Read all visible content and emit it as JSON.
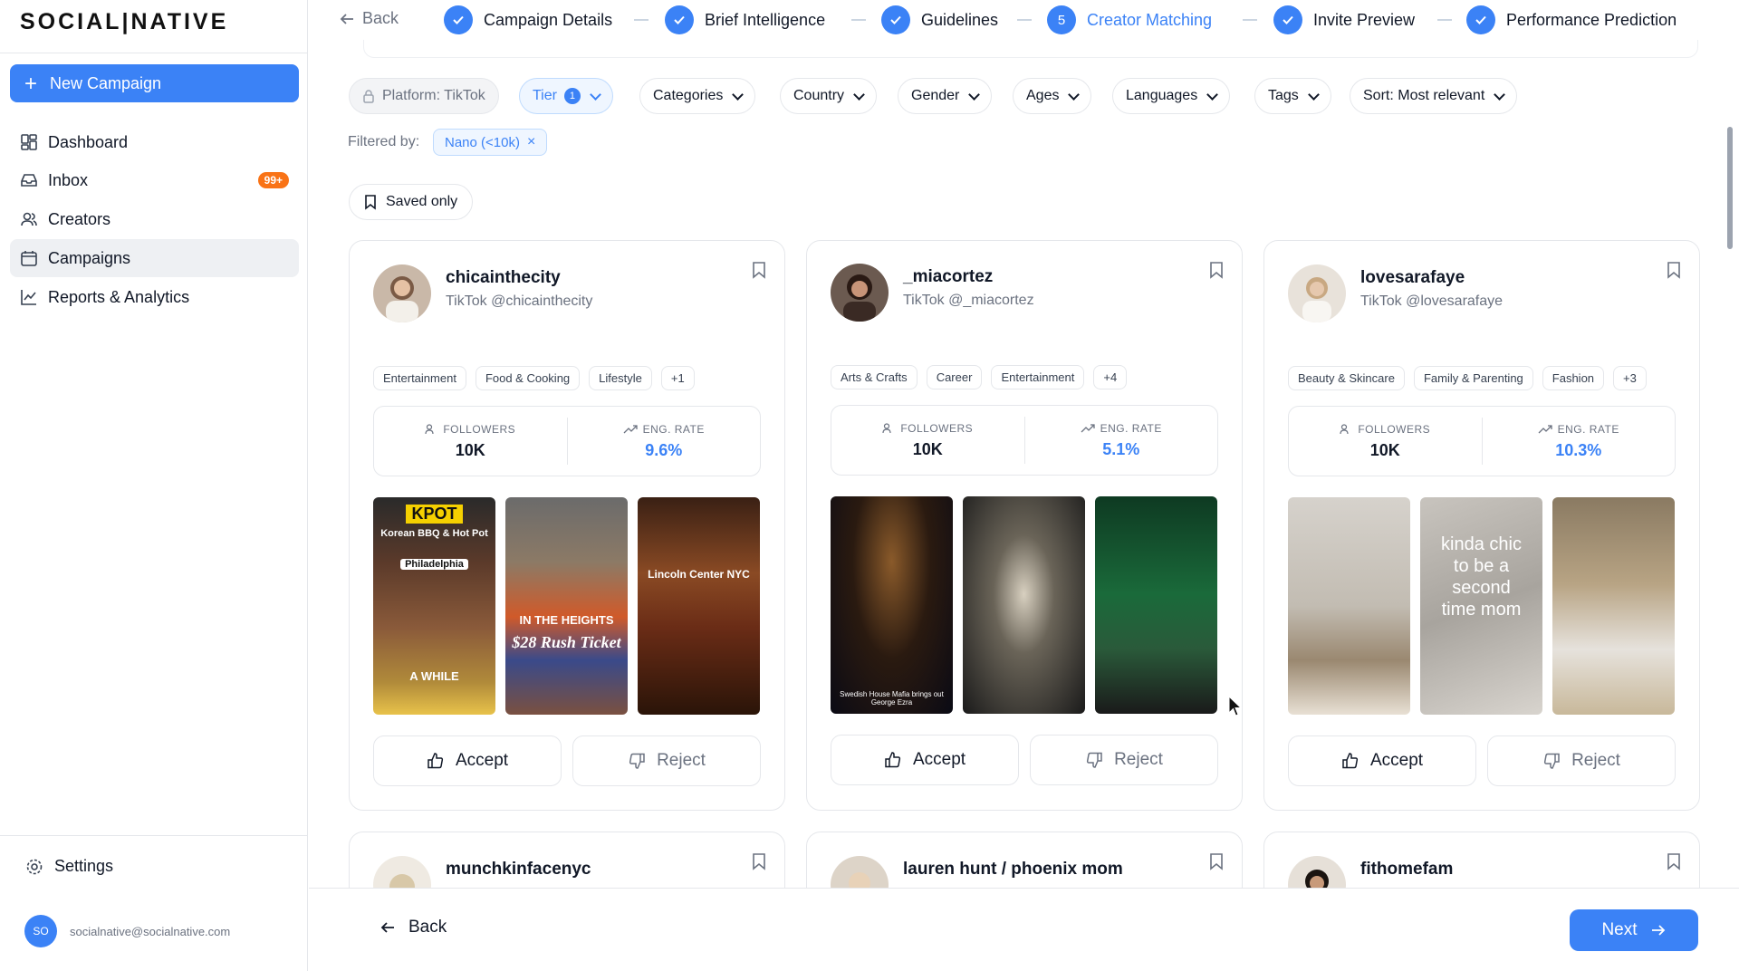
{
  "sidebar": {
    "logo": "SOCIAL|NATIVE",
    "new_campaign": "New Campaign",
    "items": [
      {
        "label": "Dashboard",
        "icon": "dashboard-icon"
      },
      {
        "label": "Inbox",
        "icon": "inbox-icon",
        "badge": "99+"
      },
      {
        "label": "Creators",
        "icon": "users-icon"
      },
      {
        "label": "Campaigns",
        "icon": "calendar-icon",
        "active": true
      },
      {
        "label": "Reports & Analytics",
        "icon": "chart-icon"
      }
    ],
    "settings": "Settings",
    "user": {
      "initials": "SO",
      "email": "socialnative@socialnative.com"
    }
  },
  "stepper": {
    "back": "Back",
    "steps": [
      {
        "label": "Campaign Details",
        "state": "done"
      },
      {
        "label": "Brief Intelligence",
        "state": "done"
      },
      {
        "label": "Guidelines",
        "state": "done"
      },
      {
        "label": "Creator Matching",
        "state": "current",
        "number": "5"
      },
      {
        "label": "Invite Preview",
        "state": "done"
      },
      {
        "label": "Performance Prediction",
        "state": "done"
      }
    ]
  },
  "filters": {
    "platform": "Platform: TikTok",
    "tier": "Tier",
    "tier_count": "1",
    "categories": "Categories",
    "country": "Country",
    "gender": "Gender",
    "ages": "Ages",
    "languages": "Languages",
    "tags": "Tags",
    "sort": "Sort: Most relevant",
    "filtered_by": "Filtered by:",
    "active_filter": "Nano (<10k)",
    "saved_only": "Saved only"
  },
  "creators": [
    {
      "name": "chicainthecity",
      "handle": "TikTok @chicainthecity",
      "tags": [
        "Entertainment",
        "Food & Cooking",
        "Lifestyle",
        "+1"
      ],
      "followers_label": "FOLLOWERS",
      "followers": "10K",
      "eng_label": "ENG. RATE",
      "eng_rate": "9.6%",
      "thumb_texts": [
        "KPOT",
        "Korean BBQ & Hot Pot",
        "Philadelphia",
        "A WHILE",
        "IN THE HEIGHTS",
        "$28 Rush Ticket",
        "Lincoln Center NYC"
      ],
      "accept": "Accept",
      "reject": "Reject"
    },
    {
      "name": "_miacortez",
      "handle": "TikTok @_miacortez",
      "tags": [
        "Arts & Crafts",
        "Career",
        "Entertainment",
        "+4"
      ],
      "followers_label": "FOLLOWERS",
      "followers": "10K",
      "eng_label": "ENG. RATE",
      "eng_rate": "5.1%",
      "thumb_texts": [
        "Swedish House Mafia brings out George Ezra"
      ],
      "accept": "Accept",
      "reject": "Reject"
    },
    {
      "name": "lovesarafaye",
      "handle": "TikTok @lovesarafaye",
      "tags": [
        "Beauty & Skincare",
        "Family & Parenting",
        "Fashion",
        "+3"
      ],
      "followers_label": "FOLLOWERS",
      "followers": "10K",
      "eng_label": "ENG. RATE",
      "eng_rate": "10.3%",
      "thumb_texts": [
        "kinda chic to be a second time mom"
      ],
      "accept": "Accept",
      "reject": "Reject"
    }
  ],
  "next_row": [
    "munchkinfacenyc",
    "lauren hunt / phoenix mom",
    "fithomefam"
  ],
  "bottom": {
    "back": "Back",
    "next": "Next"
  },
  "colors": {
    "accent": "#3b82f6",
    "badge": "#f97316"
  }
}
